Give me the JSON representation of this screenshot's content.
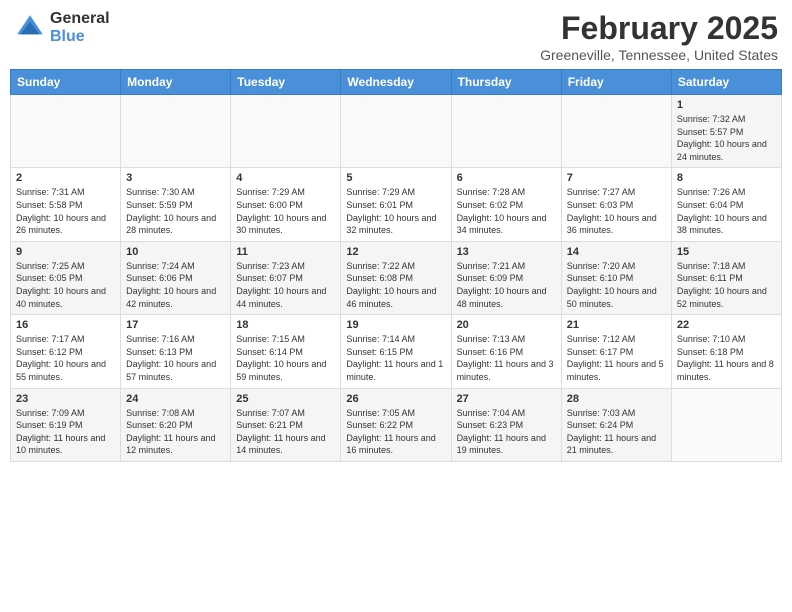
{
  "header": {
    "logo_general": "General",
    "logo_blue": "Blue",
    "month_title": "February 2025",
    "location": "Greeneville, Tennessee, United States"
  },
  "columns": [
    "Sunday",
    "Monday",
    "Tuesday",
    "Wednesday",
    "Thursday",
    "Friday",
    "Saturday"
  ],
  "weeks": [
    {
      "days": [
        {
          "num": "",
          "info": ""
        },
        {
          "num": "",
          "info": ""
        },
        {
          "num": "",
          "info": ""
        },
        {
          "num": "",
          "info": ""
        },
        {
          "num": "",
          "info": ""
        },
        {
          "num": "",
          "info": ""
        },
        {
          "num": "1",
          "info": "Sunrise: 7:32 AM\nSunset: 5:57 PM\nDaylight: 10 hours and 24 minutes."
        }
      ]
    },
    {
      "days": [
        {
          "num": "2",
          "info": "Sunrise: 7:31 AM\nSunset: 5:58 PM\nDaylight: 10 hours and 26 minutes."
        },
        {
          "num": "3",
          "info": "Sunrise: 7:30 AM\nSunset: 5:59 PM\nDaylight: 10 hours and 28 minutes."
        },
        {
          "num": "4",
          "info": "Sunrise: 7:29 AM\nSunset: 6:00 PM\nDaylight: 10 hours and 30 minutes."
        },
        {
          "num": "5",
          "info": "Sunrise: 7:29 AM\nSunset: 6:01 PM\nDaylight: 10 hours and 32 minutes."
        },
        {
          "num": "6",
          "info": "Sunrise: 7:28 AM\nSunset: 6:02 PM\nDaylight: 10 hours and 34 minutes."
        },
        {
          "num": "7",
          "info": "Sunrise: 7:27 AM\nSunset: 6:03 PM\nDaylight: 10 hours and 36 minutes."
        },
        {
          "num": "8",
          "info": "Sunrise: 7:26 AM\nSunset: 6:04 PM\nDaylight: 10 hours and 38 minutes."
        }
      ]
    },
    {
      "days": [
        {
          "num": "9",
          "info": "Sunrise: 7:25 AM\nSunset: 6:05 PM\nDaylight: 10 hours and 40 minutes."
        },
        {
          "num": "10",
          "info": "Sunrise: 7:24 AM\nSunset: 6:06 PM\nDaylight: 10 hours and 42 minutes."
        },
        {
          "num": "11",
          "info": "Sunrise: 7:23 AM\nSunset: 6:07 PM\nDaylight: 10 hours and 44 minutes."
        },
        {
          "num": "12",
          "info": "Sunrise: 7:22 AM\nSunset: 6:08 PM\nDaylight: 10 hours and 46 minutes."
        },
        {
          "num": "13",
          "info": "Sunrise: 7:21 AM\nSunset: 6:09 PM\nDaylight: 10 hours and 48 minutes."
        },
        {
          "num": "14",
          "info": "Sunrise: 7:20 AM\nSunset: 6:10 PM\nDaylight: 10 hours and 50 minutes."
        },
        {
          "num": "15",
          "info": "Sunrise: 7:18 AM\nSunset: 6:11 PM\nDaylight: 10 hours and 52 minutes."
        }
      ]
    },
    {
      "days": [
        {
          "num": "16",
          "info": "Sunrise: 7:17 AM\nSunset: 6:12 PM\nDaylight: 10 hours and 55 minutes."
        },
        {
          "num": "17",
          "info": "Sunrise: 7:16 AM\nSunset: 6:13 PM\nDaylight: 10 hours and 57 minutes."
        },
        {
          "num": "18",
          "info": "Sunrise: 7:15 AM\nSunset: 6:14 PM\nDaylight: 10 hours and 59 minutes."
        },
        {
          "num": "19",
          "info": "Sunrise: 7:14 AM\nSunset: 6:15 PM\nDaylight: 11 hours and 1 minute."
        },
        {
          "num": "20",
          "info": "Sunrise: 7:13 AM\nSunset: 6:16 PM\nDaylight: 11 hours and 3 minutes."
        },
        {
          "num": "21",
          "info": "Sunrise: 7:12 AM\nSunset: 6:17 PM\nDaylight: 11 hours and 5 minutes."
        },
        {
          "num": "22",
          "info": "Sunrise: 7:10 AM\nSunset: 6:18 PM\nDaylight: 11 hours and 8 minutes."
        }
      ]
    },
    {
      "days": [
        {
          "num": "23",
          "info": "Sunrise: 7:09 AM\nSunset: 6:19 PM\nDaylight: 11 hours and 10 minutes."
        },
        {
          "num": "24",
          "info": "Sunrise: 7:08 AM\nSunset: 6:20 PM\nDaylight: 11 hours and 12 minutes."
        },
        {
          "num": "25",
          "info": "Sunrise: 7:07 AM\nSunset: 6:21 PM\nDaylight: 11 hours and 14 minutes."
        },
        {
          "num": "26",
          "info": "Sunrise: 7:05 AM\nSunset: 6:22 PM\nDaylight: 11 hours and 16 minutes."
        },
        {
          "num": "27",
          "info": "Sunrise: 7:04 AM\nSunset: 6:23 PM\nDaylight: 11 hours and 19 minutes."
        },
        {
          "num": "28",
          "info": "Sunrise: 7:03 AM\nSunset: 6:24 PM\nDaylight: 11 hours and 21 minutes."
        },
        {
          "num": "",
          "info": ""
        }
      ]
    }
  ]
}
